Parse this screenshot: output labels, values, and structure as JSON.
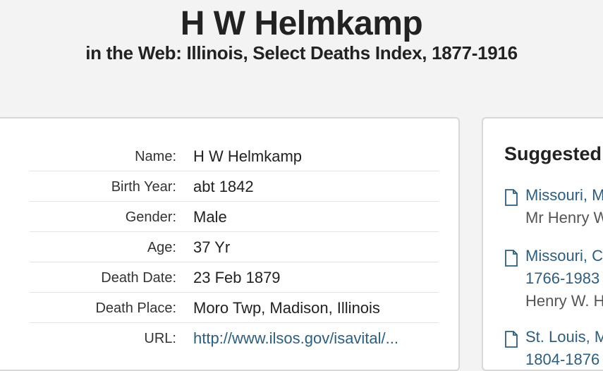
{
  "header": {
    "title": "H W Helmkamp",
    "subtitle": "in the Web: Illinois, Select Deaths Index, 1877-1916"
  },
  "record": {
    "rows": [
      {
        "label": "Name:",
        "value": "H W Helmkamp"
      },
      {
        "label": "Birth Year:",
        "value": "abt 1842"
      },
      {
        "label": "Gender:",
        "value": "Male"
      },
      {
        "label": "Age:",
        "value": "37 Yr"
      },
      {
        "label": "Death Date:",
        "value": "23 Feb 1879"
      },
      {
        "label": "Death Place:",
        "value": "Moro Twp, Madison, Illinois"
      },
      {
        "label": "URL:",
        "value": "http://www.ilsos.gov/isavital/..."
      }
    ]
  },
  "sidebar": {
    "title": "Suggested",
    "items": [
      {
        "title": "Missouri, M",
        "person": "Mr Henry W"
      },
      {
        "title": "Missouri, Co",
        "subtitle": "1766-1983",
        "person": "Henry W. H"
      },
      {
        "title": "St. Louis, M",
        "subtitle": "1804-1876"
      }
    ]
  },
  "colors": {
    "link": "#2f5d7c",
    "background": "#f3f3f3",
    "card": "#ffffff"
  },
  "icons": [
    "document-icon"
  ]
}
